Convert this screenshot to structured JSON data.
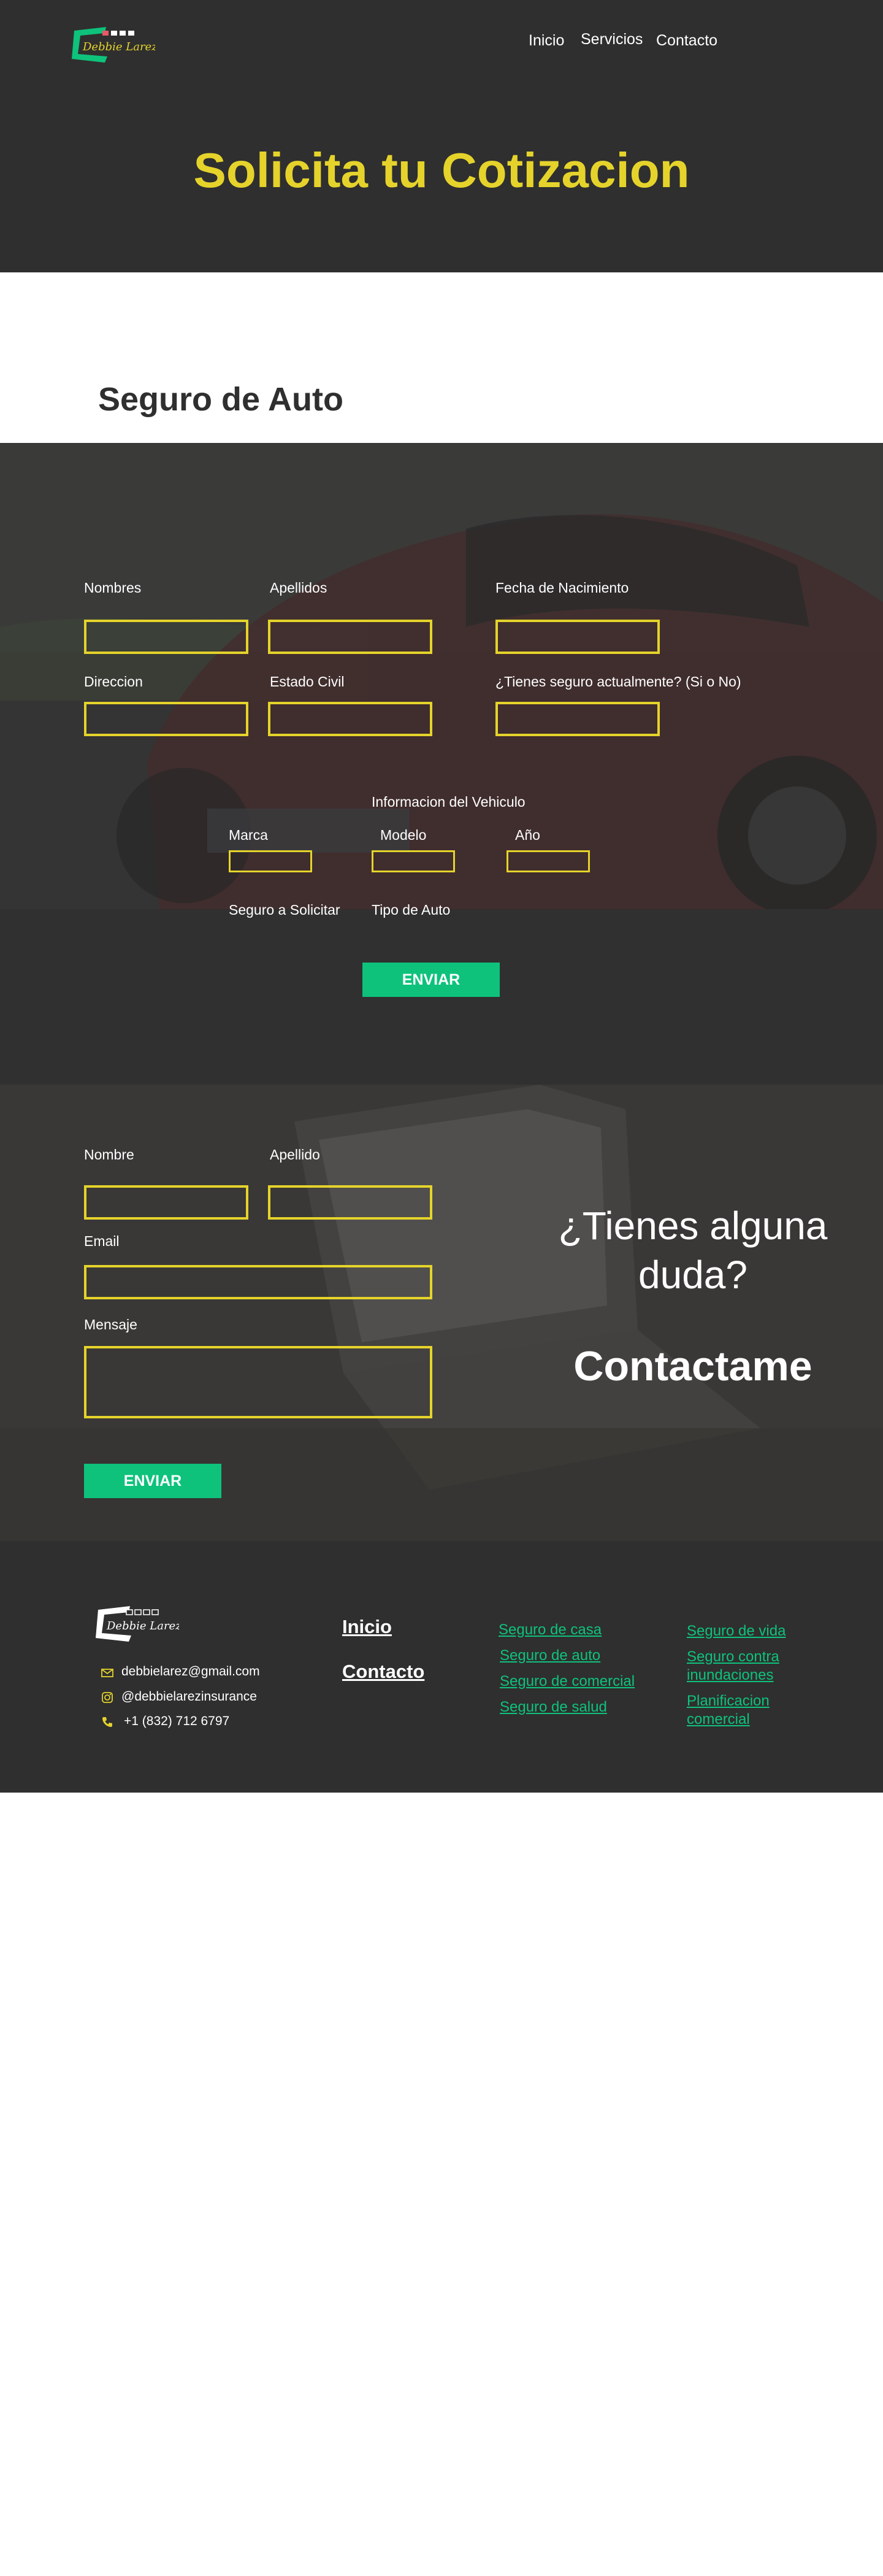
{
  "nav": {
    "logo_text": "Debbie Larez",
    "items": [
      {
        "label": "Inicio"
      },
      {
        "label": "Servicios"
      },
      {
        "label": "Contacto"
      }
    ]
  },
  "hero": {
    "title": "Solicita tu Cotizacion"
  },
  "auto_section": {
    "title": "Seguro de Auto"
  },
  "quote_form": {
    "fields": {
      "nombres": {
        "label": "Nombres",
        "value": ""
      },
      "apellidos": {
        "label": "Apellidos",
        "value": ""
      },
      "fecha_nacimiento": {
        "label": "Fecha de Nacimiento",
        "value": ""
      },
      "direccion": {
        "label": "Direccion",
        "value": ""
      },
      "estado_civil": {
        "label": "Estado Civil",
        "value": ""
      },
      "seguro_actual": {
        "label": "¿Tienes seguro actualmente? (Si o No)",
        "value": ""
      }
    },
    "vehicle": {
      "heading": "Informacion del Vehiculo",
      "marca": {
        "label": "Marca",
        "value": ""
      },
      "modelo": {
        "label": "Modelo",
        "value": ""
      },
      "anio": {
        "label": "Año",
        "value": ""
      }
    },
    "seguro_solicitar": {
      "label": "Seguro a Solicitar"
    },
    "tipo_auto": {
      "label": "Tipo de Auto"
    },
    "submit_label": "ENVIAR"
  },
  "contact_form": {
    "nombre": {
      "label": "Nombre",
      "value": ""
    },
    "apellido": {
      "label": "Apellido",
      "value": ""
    },
    "email": {
      "label": "Email",
      "value": ""
    },
    "mensaje": {
      "label": "Mensaje",
      "value": ""
    },
    "submit_label": "ENVIAR",
    "question": "¿Tienes alguna duda?",
    "cta": "Contactame"
  },
  "footer": {
    "logo_text": "Debbie Larez",
    "email": "debbielarez@gmail.com",
    "instagram": "@debbielarezinsurance",
    "phone": "+1 (832) 712 6797",
    "nav": [
      {
        "label": "Inicio"
      },
      {
        "label": "Contacto"
      }
    ],
    "services_col1": [
      {
        "label": "Seguro de casa"
      },
      {
        "label": "Seguro de auto"
      },
      {
        "label": "Seguro de comercial"
      },
      {
        "label": "Seguro de salud"
      }
    ],
    "services_col2": [
      {
        "label": "Seguro de vida"
      },
      {
        "label": "Seguro contra inundaciones"
      },
      {
        "label": "Planificacion comercial"
      }
    ]
  },
  "colors": {
    "dark": "#2f2f2f",
    "accent_yellow": "#e5d32b",
    "accent_green": "#0ec27c",
    "logo_red": "#e85a66"
  },
  "icons": [
    "logo-icon",
    "mail-icon",
    "instagram-icon",
    "phone-icon"
  ]
}
